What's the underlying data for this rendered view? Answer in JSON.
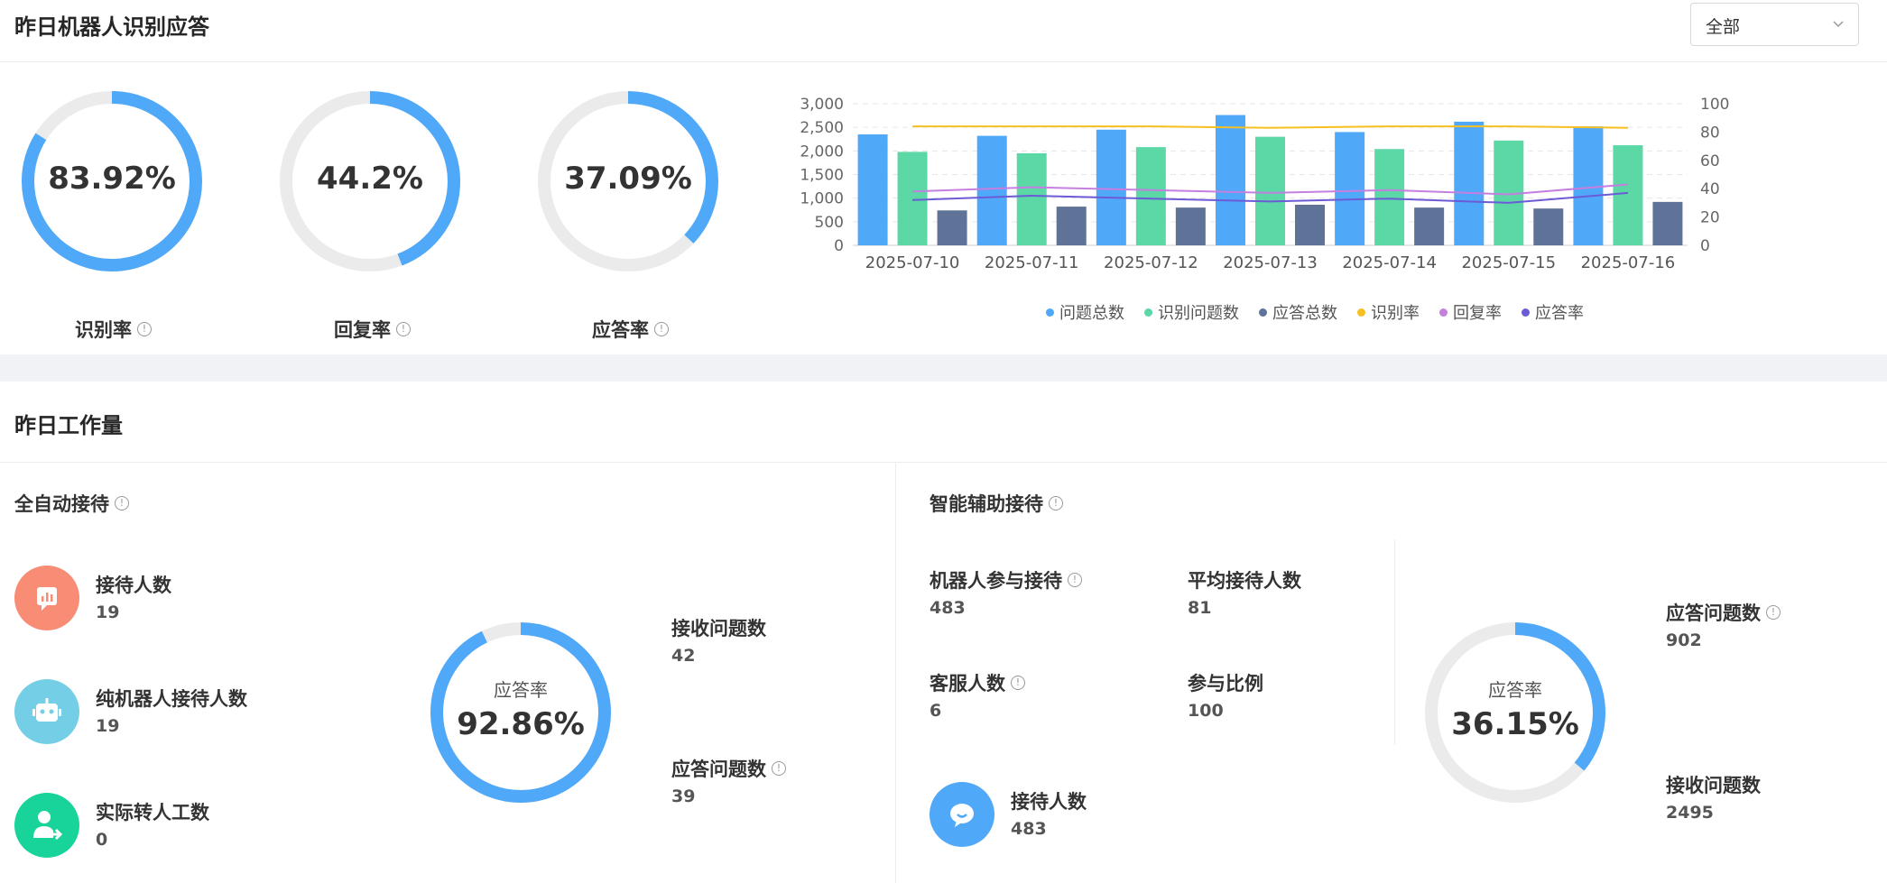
{
  "header": {
    "title": "昨日机器人识别应答",
    "select_value": "全部"
  },
  "rings": [
    {
      "value_text": "83.92%",
      "label": "识别率",
      "percent": 83.92
    },
    {
      "value_text": "44.2%",
      "label": "回复率",
      "percent": 44.2
    },
    {
      "value_text": "37.09%",
      "label": "应答率",
      "percent": 37.09
    }
  ],
  "chart_data": {
    "type": "bar",
    "categories": [
      "2025-07-10",
      "2025-07-11",
      "2025-07-12",
      "2025-07-13",
      "2025-07-14",
      "2025-07-15",
      "2025-07-16"
    ],
    "left_ticks": [
      "3,000",
      "2,500",
      "2,000",
      "1,500",
      "1,000",
      "500",
      "0"
    ],
    "right_ticks": [
      "100",
      "80",
      "60",
      "40",
      "20",
      "0"
    ],
    "ylim_left": [
      0,
      3000
    ],
    "ylim_right": [
      0,
      100
    ],
    "grid": true,
    "legend_position": "bottom",
    "series": [
      {
        "name": "问题总数",
        "kind": "bar",
        "axis": "left",
        "color": "#4fa8f8",
        "values": [
          2350,
          2320,
          2450,
          2760,
          2400,
          2620,
          2520
        ]
      },
      {
        "name": "识别问题数",
        "kind": "bar",
        "axis": "left",
        "color": "#5bd8a6",
        "values": [
          1980,
          1950,
          2080,
          2300,
          2040,
          2220,
          2120
        ]
      },
      {
        "name": "应答总数",
        "kind": "bar",
        "axis": "left",
        "color": "#5f7399",
        "values": [
          740,
          820,
          800,
          860,
          800,
          780,
          920
        ]
      },
      {
        "name": "识别率",
        "kind": "line",
        "axis": "right",
        "color": "#f6c022",
        "values": [
          84,
          84,
          84,
          83,
          84,
          84,
          83
        ]
      },
      {
        "name": "回复率",
        "kind": "line",
        "axis": "right",
        "color": "#c47fe0",
        "values": [
          38,
          41,
          39,
          37,
          39,
          36,
          43
        ]
      },
      {
        "name": "应答率",
        "kind": "line",
        "axis": "right",
        "color": "#6b5bd6",
        "values": [
          32,
          35,
          33,
          31,
          33,
          30,
          37
        ]
      }
    ]
  },
  "workload": {
    "title": "昨日工作量",
    "auto": {
      "title": "全自动接待",
      "items": [
        {
          "label": "接待人数",
          "value": "19",
          "icon": "chart-icon",
          "color": "#f98c74"
        },
        {
          "label": "纯机器人接待人数",
          "value": "19",
          "icon": "robot-icon",
          "color": "#74cfe6"
        },
        {
          "label": "实际转人工数",
          "value": "0",
          "icon": "transfer-person-icon",
          "color": "#18d49a"
        }
      ],
      "ring": {
        "label": "应答率",
        "value_text": "92.86%",
        "percent": 92.86
      },
      "received_label": "接收问题数",
      "received_value": "42",
      "answered_label": "应答问题数",
      "answered_value": "39"
    },
    "assist": {
      "title": "智能辅助接待",
      "robot_participate_label": "机器人参与接待",
      "robot_participate_value": "483",
      "avg_label": "平均接待人数",
      "avg_value": "81",
      "agents_label": "客服人数",
      "agents_value": "6",
      "ratio_label": "参与比例",
      "ratio_value": "100",
      "reception_label": "接待人数",
      "reception_value": "483",
      "reception_icon": "chat-bubble-icon",
      "reception_color": "#4fa8f8",
      "ring": {
        "label": "应答率",
        "value_text": "36.15%",
        "percent": 36.15
      },
      "answered_label": "应答问题数",
      "answered_value": "902",
      "received_label": "接收问题数",
      "received_value": "2495"
    }
  },
  "colors": {
    "accent": "#4fa8f8",
    "track": "#ebebeb"
  }
}
